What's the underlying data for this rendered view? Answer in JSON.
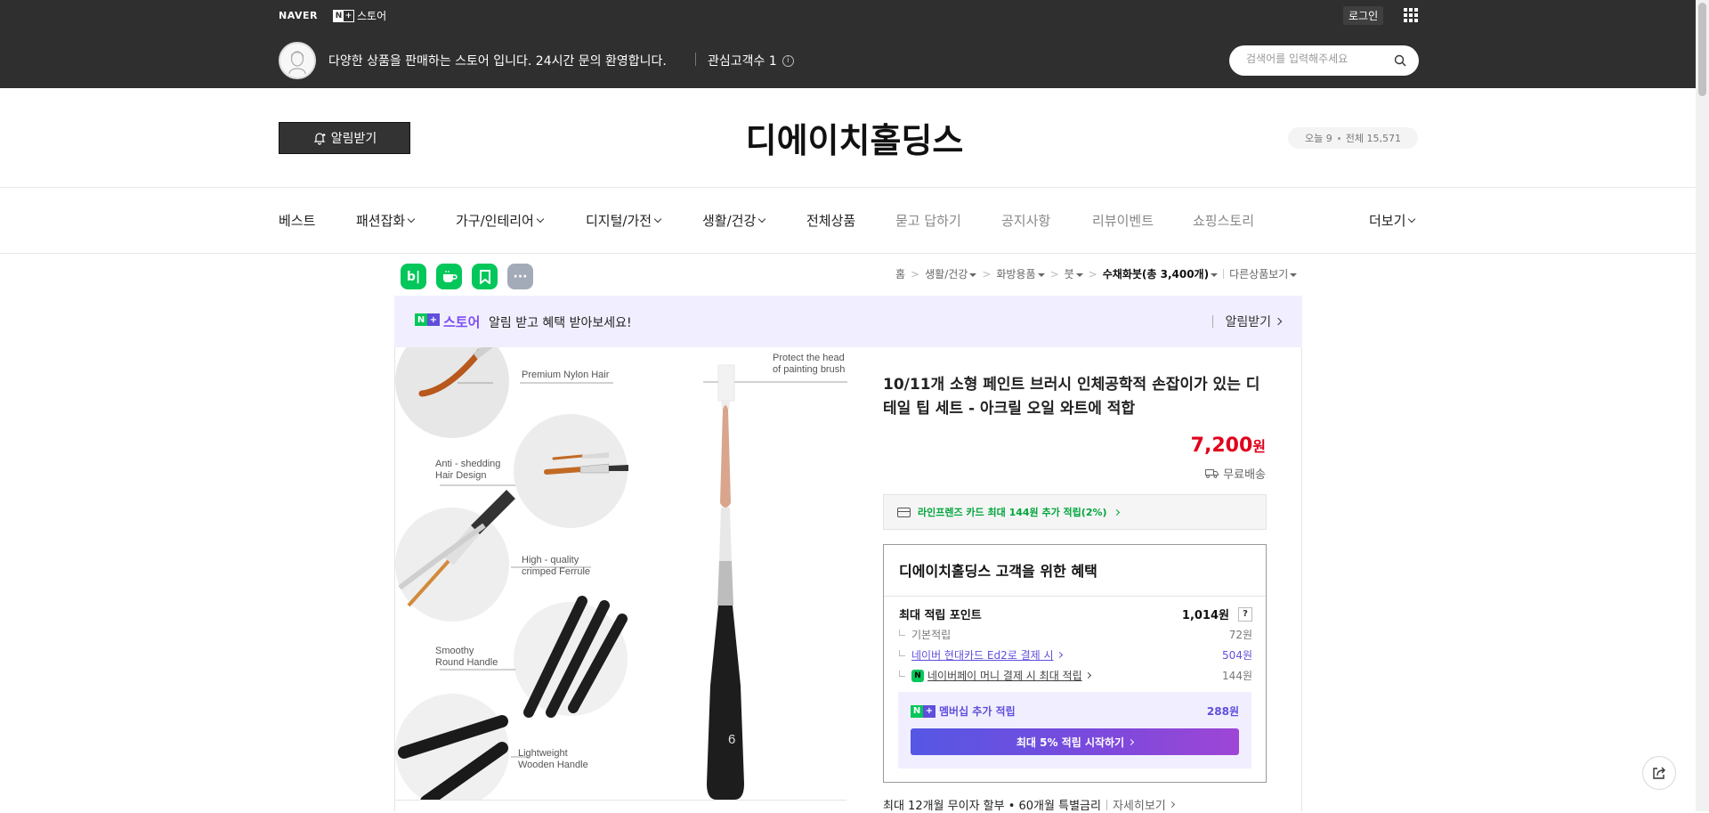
{
  "topbar": {
    "naver_logo": "NAVER",
    "store_badge_left": "N",
    "store_badge_right": "+",
    "store_label": "스토어",
    "login_label": "로그인",
    "store_description": "다양한 상품을 판매하는 스토어 입니다. 24시간 문의 환영합니다.",
    "interest_label": "관심고객수 1",
    "info_glyph": "i",
    "search_placeholder": "검색어를 입력해주세요",
    "background_color": "#2f2f2f"
  },
  "store": {
    "alarm_button_label": "알림받기",
    "name": "디에이치홀딩스",
    "today_label": "오늘 9",
    "total_label": "전체 15,571"
  },
  "nav": {
    "items": [
      {
        "label": "베스트",
        "dropdown": false,
        "muted": false
      },
      {
        "label": "패션잡화",
        "dropdown": true,
        "muted": false
      },
      {
        "label": "가구/인테리어",
        "dropdown": true,
        "muted": false
      },
      {
        "label": "디지털/가전",
        "dropdown": true,
        "muted": false
      },
      {
        "label": "생활/건강",
        "dropdown": true,
        "muted": false
      },
      {
        "label": "전체상품",
        "dropdown": false,
        "muted": false
      },
      {
        "label": "묻고 답하기",
        "dropdown": false,
        "muted": true
      },
      {
        "label": "공지사항",
        "dropdown": false,
        "muted": true
      },
      {
        "label": "리뷰이벤트",
        "dropdown": false,
        "muted": true
      },
      {
        "label": "쇼핑스토리",
        "dropdown": false,
        "muted": true
      }
    ],
    "more_label": "더보기"
  },
  "services": [
    {
      "icon": "blog-icon",
      "glyph": "b|",
      "color": "#03c75a"
    },
    {
      "icon": "cafe-icon",
      "glyph": "☕",
      "color": "#03c75a"
    },
    {
      "icon": "bookmark-icon",
      "glyph": "▼",
      "color": "#03c75a"
    },
    {
      "icon": "more-icon",
      "glyph": "···",
      "color": "#a3abb8"
    }
  ],
  "breadcrumb": {
    "home": "홈",
    "level1": "생활/건강",
    "level2": "화방용품",
    "level3": "붓",
    "current": "수채화붓(총 3,400개)",
    "other": "다른상품보기",
    "separator": ">"
  },
  "promo": {
    "badge_n": "N",
    "badge_plus": "+",
    "store_word": "스토어",
    "text": "알림 받고 혜택 받아보세요!",
    "alarm_label": "알림받기"
  },
  "product_image": {
    "labels": [
      "Premium Nylon Hair",
      "Protect the  head",
      "of painting brush",
      "Anti - shedding",
      "Hair Design",
      "High - quality",
      "crimped Ferrule",
      "Smoothy",
      "Round Handle",
      "Lightweight",
      "Wooden Handle",
      "6"
    ]
  },
  "product": {
    "title": "10/11개 소형 페인트 브러시 인체공학적 손잡이가 있는 디테일 팁 세트 - 아크릴 오일 와트에 적합",
    "price_number": "7,200",
    "price_unit": "원",
    "shipping": "무료배송",
    "card_benefit": "라인프렌즈 카드 최대 144원 추가 적립(2%)"
  },
  "benefits": {
    "title": "디에이치홀딩스 고객을 위한 혜택",
    "max_points_label": "최대 적립 포인트",
    "max_points_value": "1,014원",
    "help_glyph": "?",
    "basic_label": "기본적립",
    "basic_value": "72원",
    "card_label": "네이버 현대카드 Ed2로 결제 시",
    "card_value": "504원",
    "pay_badge": "N",
    "pay_label": "네이버페이 머니 결제 시 최대 적립",
    "pay_value": "144원",
    "membership_badge_n": "N",
    "membership_badge_plus": "+",
    "membership_label": "멤버십 추가 적립",
    "membership_value": "288원",
    "membership_button": "최대 5% 적립 시작하기"
  },
  "installment": {
    "text": "최대 12개월 무이자 할부 • 60개월 특별금리",
    "more": "자세히보기"
  },
  "colors": {
    "price": "#e0001b",
    "green": "#03c75a",
    "purple": "#5f4fdc",
    "promo_bg": "#f1efff"
  }
}
